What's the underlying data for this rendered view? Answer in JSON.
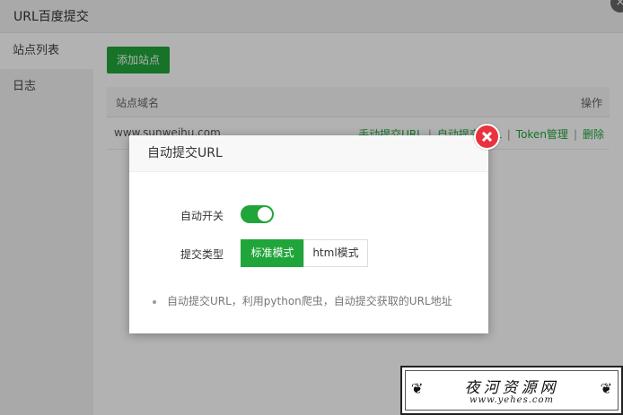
{
  "window": {
    "title": "URL百度提交",
    "close_glyph": "×"
  },
  "sidebar": {
    "items": [
      {
        "label": "站点列表",
        "active": true
      },
      {
        "label": "日志",
        "active": false
      }
    ]
  },
  "main": {
    "add_button": "添加站点",
    "table": {
      "headers": [
        "站点域名",
        "操作"
      ],
      "rows": [
        {
          "domain": "www.sunweihu.com",
          "actions": [
            "手动提交URL",
            "自动提交URL",
            "Token管理",
            "删除"
          ],
          "separator": "|"
        }
      ]
    }
  },
  "dialog": {
    "title": "自动提交URL",
    "auto_switch_label": "自动开关",
    "auto_switch_on": true,
    "submit_type_label": "提交类型",
    "submit_type_options": [
      "标准模式",
      "html模式"
    ],
    "submit_type_selected": "标准模式",
    "tip": "自动提交URL，利用python爬虫，自动提交获取的URL地址"
  },
  "watermark": {
    "title": "夜河资源网",
    "url": "www.yehes.com"
  },
  "colors": {
    "accent": "#20a53a",
    "close_red": "#e8333e",
    "overlay": "rgba(0,0,0,0.3)"
  }
}
